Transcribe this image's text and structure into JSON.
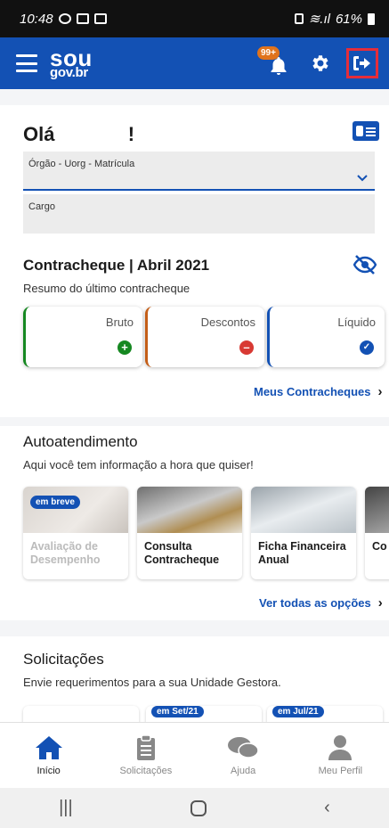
{
  "status_bar": {
    "time": "10:48",
    "battery": "61%"
  },
  "header": {
    "logo_line1": "sou",
    "logo_line2": "gov.br",
    "notification_badge": "99+"
  },
  "greeting": {
    "prefix": "Olá",
    "suffix": "!"
  },
  "fields": {
    "org_label": "Órgão - Uorg - Matrícula",
    "cargo_label": "Cargo"
  },
  "contracheque": {
    "title": "Contracheque | Abril 2021",
    "subtitle": "Resumo do último contracheque",
    "cards": [
      {
        "label": "Bruto",
        "icon": "plus-icon",
        "symbol": "+"
      },
      {
        "label": "Descontos",
        "icon": "minus-icon",
        "symbol": "–"
      },
      {
        "label": "Líquido",
        "icon": "check-icon",
        "symbol": "✓"
      }
    ],
    "link": "Meus Contracheques"
  },
  "autoatendimento": {
    "title": "Autoatendimento",
    "subtitle": "Aqui você tem informação a hora que quiser!",
    "services": [
      {
        "title": "Avaliação de Desempenho",
        "tag": "em breve"
      },
      {
        "title": "Consulta Contracheque"
      },
      {
        "title": "Ficha Financeira Anual"
      },
      {
        "title": "Co"
      }
    ],
    "link": "Ver todas as opções"
  },
  "solicitacoes": {
    "title": "Solicitações",
    "subtitle": "Envie requerimentos para a sua Unidade Gestora.",
    "tags": [
      "em Set/21",
      "em Jul/21"
    ]
  },
  "bottom_nav": [
    {
      "label": "Início",
      "icon": "home-icon"
    },
    {
      "label": "Solicitações",
      "icon": "clipboard-icon"
    },
    {
      "label": "Ajuda",
      "icon": "chat-icon"
    },
    {
      "label": "Meu Perfil",
      "icon": "user-icon"
    }
  ],
  "colors": {
    "primary": "#1351b4",
    "logout_highlight": "#e52d3a",
    "success": "#168821",
    "danger": "#d83933"
  }
}
